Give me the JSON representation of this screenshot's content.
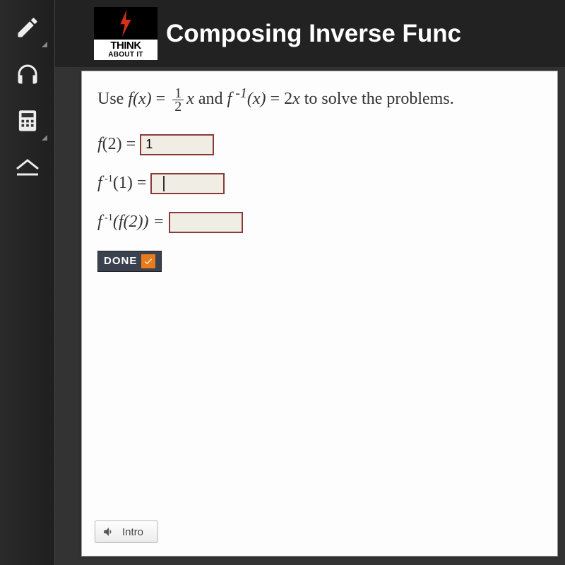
{
  "sidebar": {
    "items": [
      {
        "name": "pencil-icon"
      },
      {
        "name": "headphones-icon"
      },
      {
        "name": "calculator-icon"
      },
      {
        "name": "collapse-up-icon"
      }
    ]
  },
  "header": {
    "badge_line1": "THINK",
    "badge_line2": "ABOUT IT",
    "title": "Composing Inverse Func"
  },
  "problem": {
    "prompt_prefix": "Use ",
    "f_label": "f",
    "x_var": "x",
    "frac_num": "1",
    "frac_den": "2",
    "prompt_mid": " and ",
    "finv_rhs": "2",
    "prompt_suffix": " to solve the problems.",
    "rows": [
      {
        "lhs_prefix": "f",
        "lhs_inner": "(2) = ",
        "value": "1"
      },
      {
        "lhs_prefix": "f",
        "lhs_inner": "(1) = ",
        "value": ""
      },
      {
        "lhs_prefix": "f",
        "lhs_inner": "(f(2)) = ",
        "value": ""
      }
    ],
    "done_label": "DONE"
  },
  "footer": {
    "intro_label": "Intro"
  }
}
